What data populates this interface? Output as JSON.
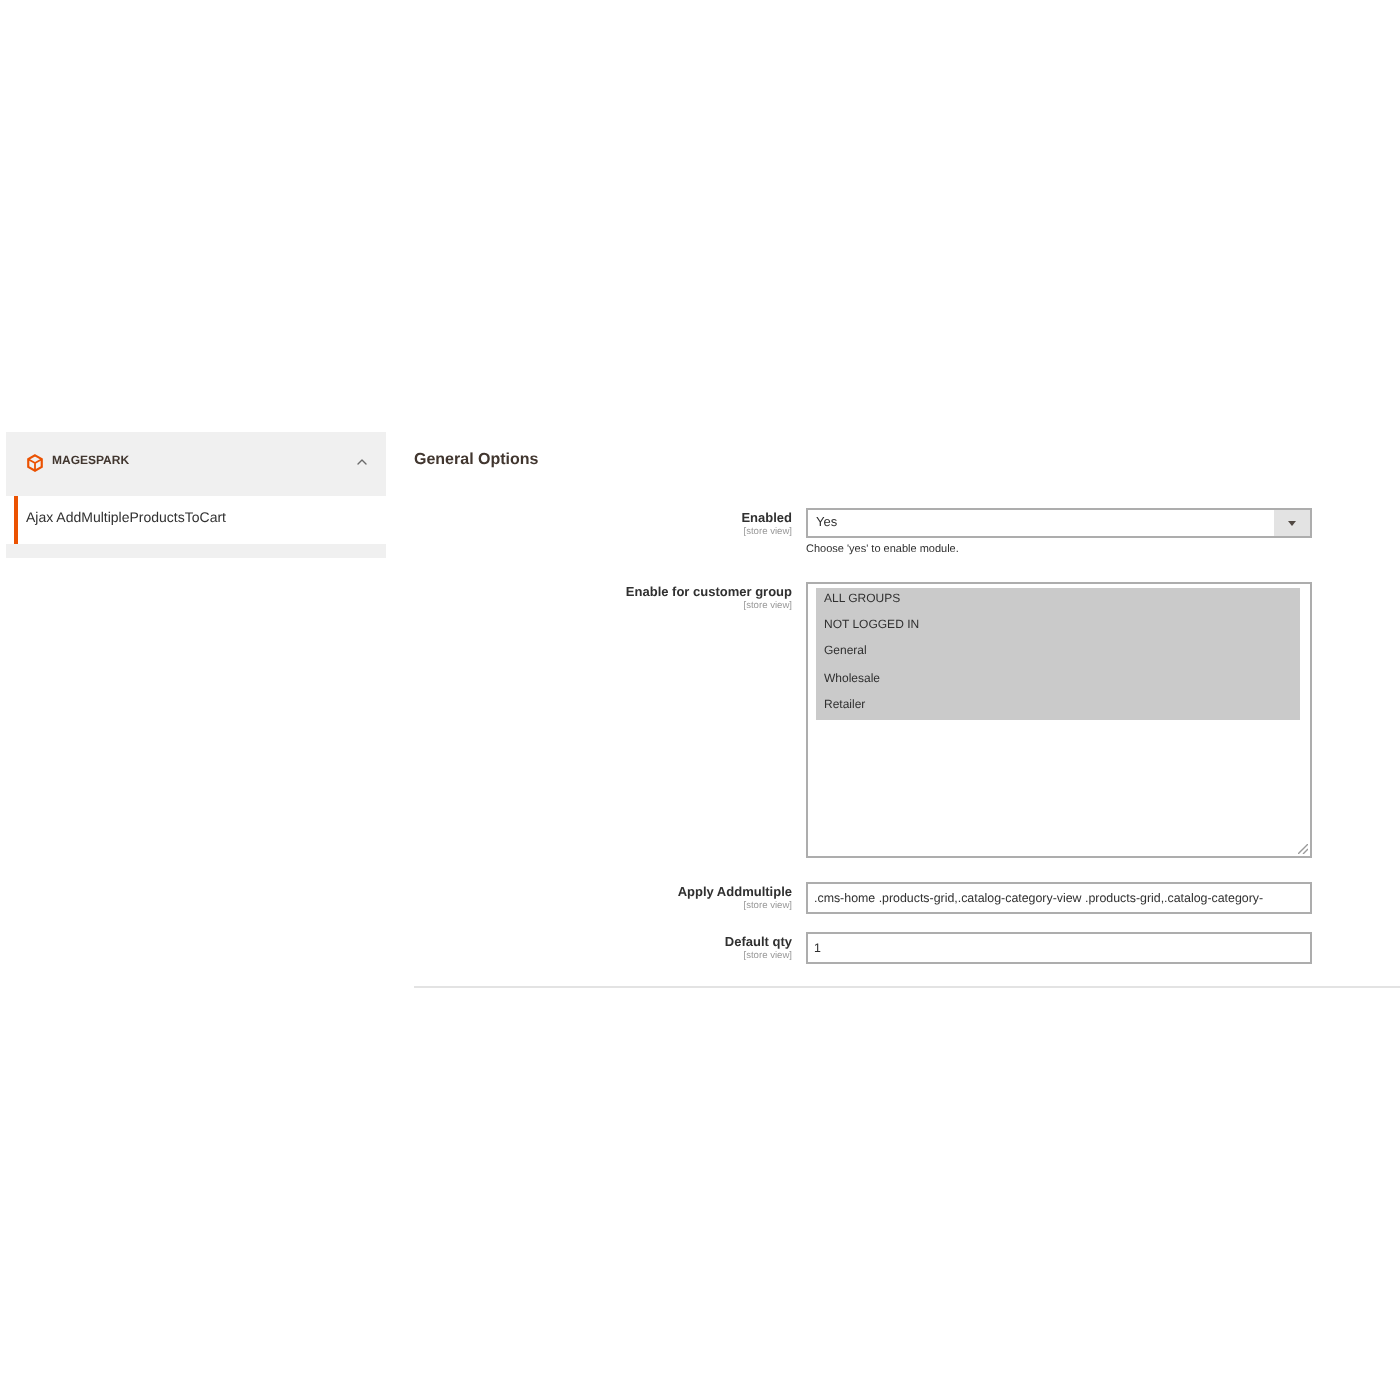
{
  "sidebar": {
    "section": {
      "title": "MAGESPARK",
      "expanded": true
    },
    "items": [
      {
        "label": "Ajax AddMultipleProductsToCart",
        "selected": true
      }
    ]
  },
  "main": {
    "title": "General Options",
    "fields": [
      {
        "kind": "select",
        "label": "Enabled",
        "scope": "[store view]",
        "value": "Yes",
        "hint": "Choose 'yes' to enable module."
      },
      {
        "kind": "multiselect",
        "label": "Enable for customer group",
        "scope": "[store view]",
        "options": [
          {
            "label": "ALL GROUPS",
            "selected": true
          },
          {
            "label": "NOT LOGGED IN",
            "selected": true
          },
          {
            "label": "General",
            "selected": true
          },
          {
            "label": "Wholesale",
            "selected": true
          },
          {
            "label": "Retailer",
            "selected": true
          }
        ]
      },
      {
        "kind": "text",
        "label": "Apply Addmultiple",
        "scope": "[store view]",
        "value": ".cms-home .products-grid,.catalog-category-view .products-grid,.catalog-category-"
      },
      {
        "kind": "text",
        "label": "Default qty",
        "scope": "[store view]",
        "value": "1"
      }
    ]
  }
}
